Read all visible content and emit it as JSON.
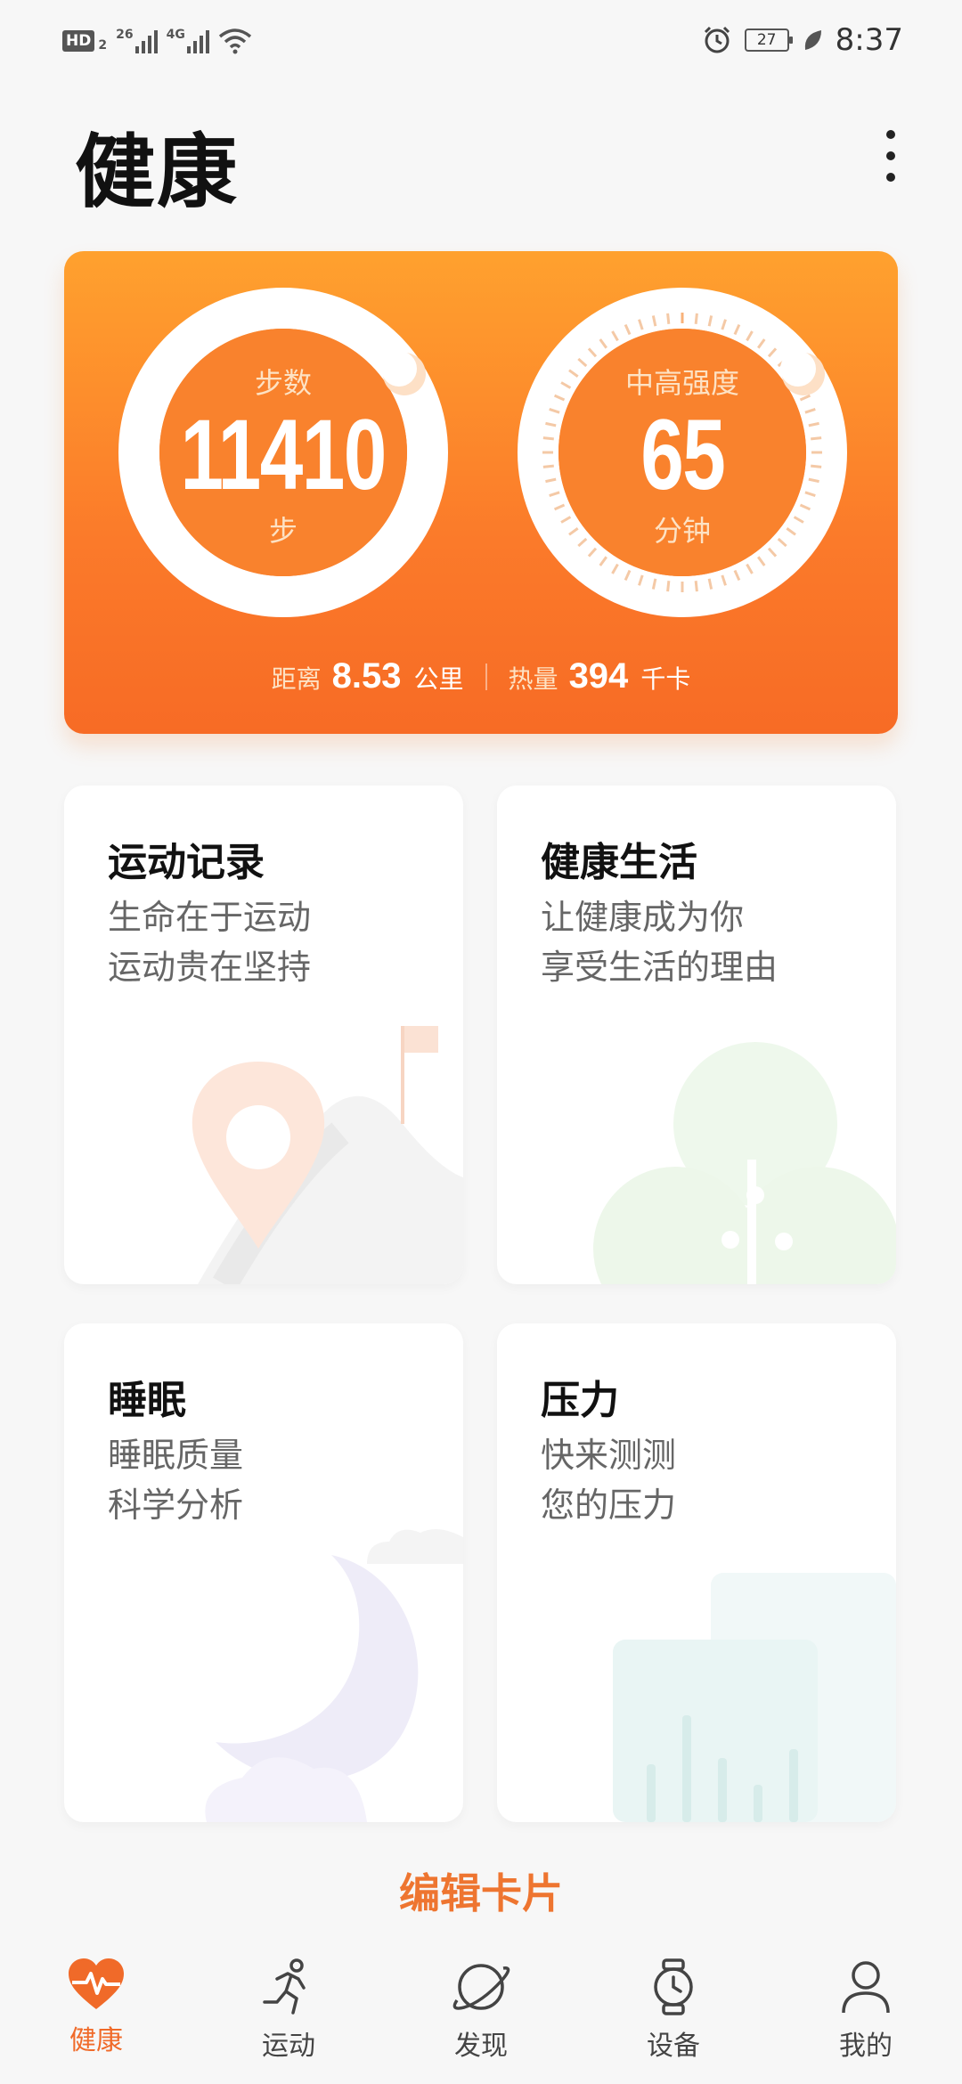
{
  "status_bar": {
    "hd_badge": "HD",
    "hd_sub": "2",
    "network_1": "26",
    "network_2": "4G",
    "battery": "27",
    "time": "8:37",
    "icons": [
      "signal-icon",
      "wifi-icon",
      "alarm-icon",
      "battery-icon",
      "leaf-icon"
    ]
  },
  "header": {
    "title": "健康"
  },
  "summary": {
    "steps": {
      "label": "步数",
      "value": "11410",
      "unit": "步"
    },
    "intensity": {
      "label": "中高强度",
      "value": "65",
      "unit": "分钟"
    },
    "distance": {
      "label": "距离",
      "value": "8.53",
      "unit": "公里"
    },
    "calories": {
      "label": "热量",
      "value": "394",
      "unit": "千卡"
    }
  },
  "cards": [
    {
      "title": "运动记录",
      "line1": "生命在于运动",
      "line2": "运动贵在坚持"
    },
    {
      "title": "健康生活",
      "line1": "让健康成为你",
      "line2": "享受生活的理由"
    },
    {
      "title": "睡眠",
      "line1": "睡眠质量",
      "line2": "科学分析"
    },
    {
      "title": "压力",
      "line1": "快来测测",
      "line2": "您的压力"
    }
  ],
  "edit_card_label": "编辑卡片",
  "nav": [
    {
      "label": "健康",
      "icon": "heart-icon",
      "active": true
    },
    {
      "label": "运动",
      "icon": "running-icon",
      "active": false
    },
    {
      "label": "发现",
      "icon": "planet-icon",
      "active": false
    },
    {
      "label": "设备",
      "icon": "watch-icon",
      "active": false
    },
    {
      "label": "我的",
      "icon": "user-icon",
      "active": false
    }
  ],
  "colors": {
    "accent": "#f06a29",
    "card_top": "#ffa12e",
    "card_bottom": "#f76b25"
  }
}
